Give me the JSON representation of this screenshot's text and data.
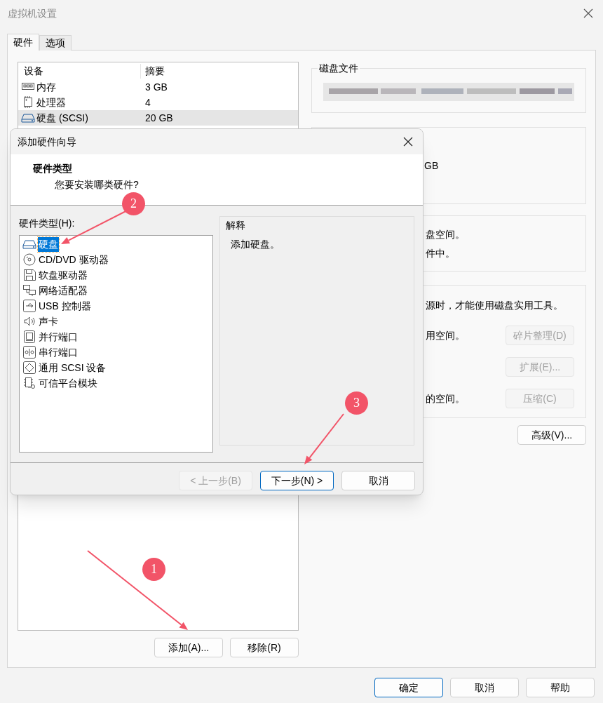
{
  "window": {
    "title": "虚拟机设置"
  },
  "tabs": [
    {
      "label": "硬件",
      "selected": true
    },
    {
      "label": "选项",
      "selected": false
    }
  ],
  "devices": {
    "columns": [
      "设备",
      "摘要"
    ],
    "rows": [
      {
        "kind": "memory",
        "name": "内存",
        "summary": "3 GB",
        "selected": false
      },
      {
        "kind": "cpu",
        "name": "处理器",
        "summary": "4",
        "selected": false
      },
      {
        "kind": "disk",
        "name": "硬盘 (SCSI)",
        "summary": "20 GB",
        "selected": true
      }
    ]
  },
  "device_buttons": [
    "添加(A)...",
    "移除(R)"
  ],
  "disk_file": {
    "title": "磁盘文件"
  },
  "capacity": {
    "value_fragment": "GB"
  },
  "info_lines": [
    "盘空间。",
    "件中。"
  ],
  "utilities": {
    "note": "源时，才能使用磁盘实用工具。",
    "rows": [
      {
        "text": "用空间。",
        "button": "碎片整理(D)",
        "disabled": true
      },
      {
        "button": "扩展(E)...",
        "disabled": true
      },
      {
        "text": "的空间。",
        "button": "压缩(C)",
        "disabled": true
      }
    ]
  },
  "advanced_button": "高级(V)...",
  "footer_buttons": [
    {
      "label": "确定",
      "default": true
    },
    {
      "label": "取消",
      "default": false
    },
    {
      "label": "帮助",
      "default": false
    }
  ],
  "dialog": {
    "title": "添加硬件向导",
    "heading": "硬件类型",
    "subheading": "您要安装哪类硬件?",
    "list_label": "硬件类型(H):",
    "hardware": [
      {
        "kind": "disk",
        "label": "硬盘",
        "selected": true
      },
      {
        "kind": "cdrom",
        "label": "CD/DVD 驱动器",
        "selected": false
      },
      {
        "kind": "floppy",
        "label": "软盘驱动器",
        "selected": false
      },
      {
        "kind": "network",
        "label": "网络适配器",
        "selected": false
      },
      {
        "kind": "usb",
        "label": "USB 控制器",
        "selected": false
      },
      {
        "kind": "sound",
        "label": "声卡",
        "selected": false
      },
      {
        "kind": "parallel",
        "label": "并行端口",
        "selected": false
      },
      {
        "kind": "serial",
        "label": "串行端口",
        "selected": false
      },
      {
        "kind": "scsi",
        "label": "通用 SCSI 设备",
        "selected": false
      },
      {
        "kind": "tpm",
        "label": "可信平台模块",
        "selected": false
      }
    ],
    "explanation": {
      "title": "解释",
      "text": "添加硬盘。"
    },
    "buttons": [
      {
        "label": "< 上一步(B)",
        "disabled": true,
        "default": false
      },
      {
        "label": "下一步(N) >",
        "disabled": false,
        "default": true
      },
      {
        "label": "取消",
        "disabled": false,
        "default": false
      }
    ]
  },
  "annotations": [
    {
      "label": "1"
    },
    {
      "label": "2"
    },
    {
      "label": "3"
    }
  ]
}
